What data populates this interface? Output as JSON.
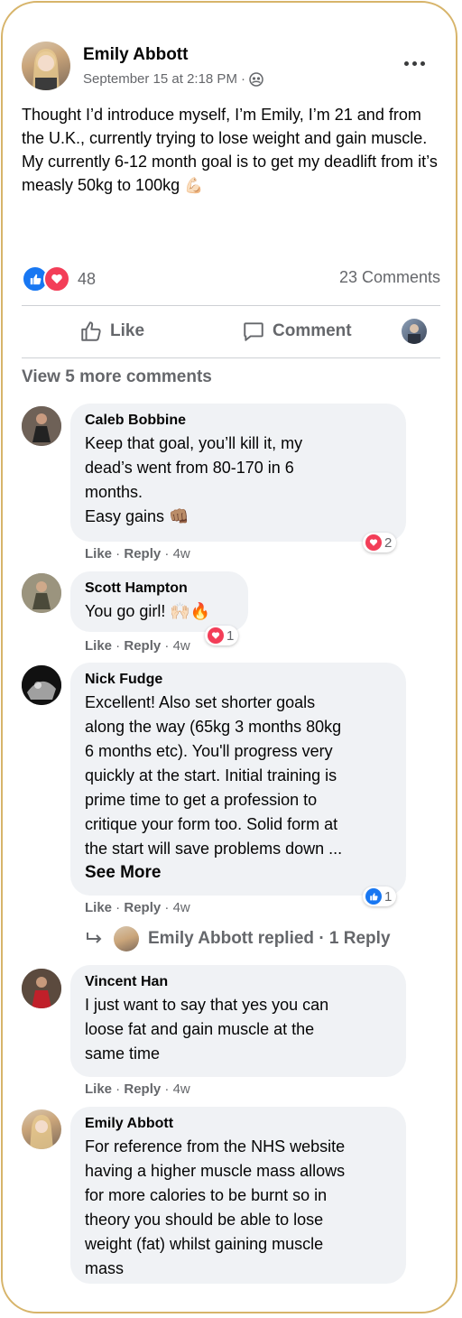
{
  "post": {
    "author": "Emily Abbott",
    "timestamp": "September 15 at 2:18 PM",
    "separator": "·",
    "text": "Thought I’d introduce myself, I’m Emily, I’m 21 and from the U.K., currently trying to lose weight and gain muscle. My currently 6-12 month goal is to get my deadlift from it’s measly 50kg to 100kg",
    "text_emoji": "💪🏻",
    "reaction_count": "48",
    "comments_count": "23 Comments",
    "more_icon": "more-options-icon"
  },
  "actions": {
    "like": "Like",
    "comment": "Comment"
  },
  "view_more": "View 5 more comments",
  "comments": [
    {
      "name": "Caleb Bobbine",
      "text": "Keep that goal, you’ll kill it, my\ndead’s went from 80-170 in 6\nmonths.\nEasy gains 👊🏽",
      "like": "Like",
      "reply": "Reply",
      "time": "4w",
      "reactions": "2"
    },
    {
      "name": "Scott Hampton",
      "text": "You go girl! 🙌🏻🔥",
      "like": "Like",
      "reply": "Reply",
      "time": "4w",
      "reactions": "1"
    },
    {
      "name": "Nick Fudge",
      "text": "Excellent! Also set shorter goals\nalong the way (65kg 3 months 80kg\n6 months etc). You'll progress very\nquickly at the start. Initial training is\nprime time to get a profession to\ncritique your form too. Solid form at\nthe start will save problems down ...",
      "see_more": "See More",
      "like": "Like",
      "reply": "Reply",
      "time": "4w",
      "reactions": "1",
      "replied": "Emily Abbott replied · 1 Reply"
    },
    {
      "name": "Vincent Han",
      "text": "I just want to say that yes you can\nloose fat and gain muscle at the\nsame time",
      "like": "Like",
      "reply": "Reply",
      "time": "4w"
    },
    {
      "name": "Emily Abbott",
      "text": "For reference from the NHS website\nhaving a higher muscle mass allows\nfor more calories to be burnt so in\ntheory you should be able to lose\nweight (fat) whilst gaining muscle\nmass"
    }
  ],
  "colors": {
    "like_blue": "#1877f2",
    "heart_red": "#f33e58",
    "frame_gold": "#d7b46a",
    "bubble_bg": "#f0f2f5",
    "meta_gray": "#65676b"
  }
}
